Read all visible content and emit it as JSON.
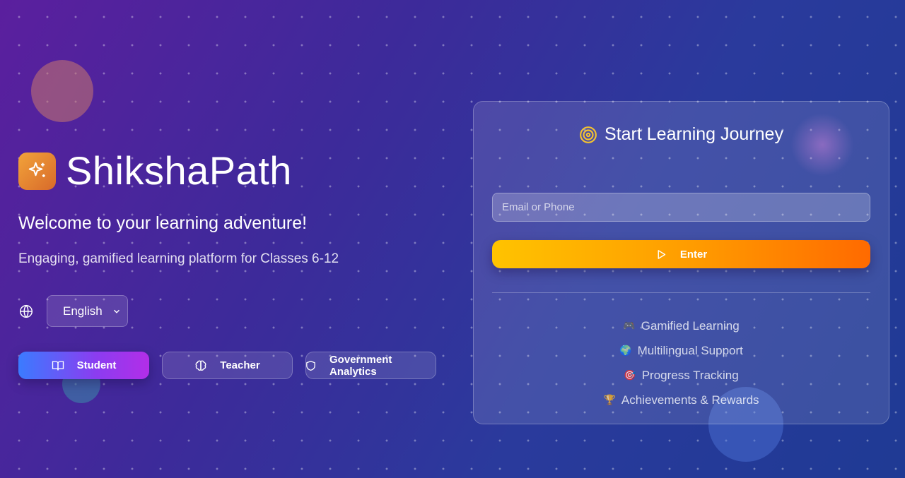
{
  "brand": {
    "name": "ShikshaPath",
    "logo_icon": "sparkles-icon",
    "accent": "#e8902f"
  },
  "hero": {
    "welcome": "Welcome to your learning adventure!",
    "tagline": "Engaging, gamified learning platform for Classes 6-12"
  },
  "language": {
    "icon": "globe-icon",
    "selected": "English"
  },
  "roles": [
    {
      "label": "Student",
      "icon": "book-open-icon",
      "active": true
    },
    {
      "label": "Teacher",
      "icon": "brain-icon",
      "active": false
    },
    {
      "label": "Government Analytics",
      "icon": "shield-icon",
      "active": false
    }
  ],
  "login": {
    "title": "Start Learning Journey",
    "title_icon": "target-icon",
    "input_placeholder": "Email or Phone",
    "enter_label": "Enter",
    "enter_icon": "play-icon"
  },
  "features": [
    {
      "emoji": "🎮",
      "label": "Gamified Learning"
    },
    {
      "emoji": "🌍",
      "label": "Multilingual Support"
    },
    {
      "emoji": "🎯",
      "label": "Progress Tracking"
    },
    {
      "emoji": "🏆",
      "label": "Achievements & Rewards"
    }
  ],
  "colors": {
    "student_gradient": [
      "#3b7bff",
      "#b22ee8"
    ],
    "enter_gradient": [
      "#ffc300",
      "#ff6a00"
    ]
  }
}
